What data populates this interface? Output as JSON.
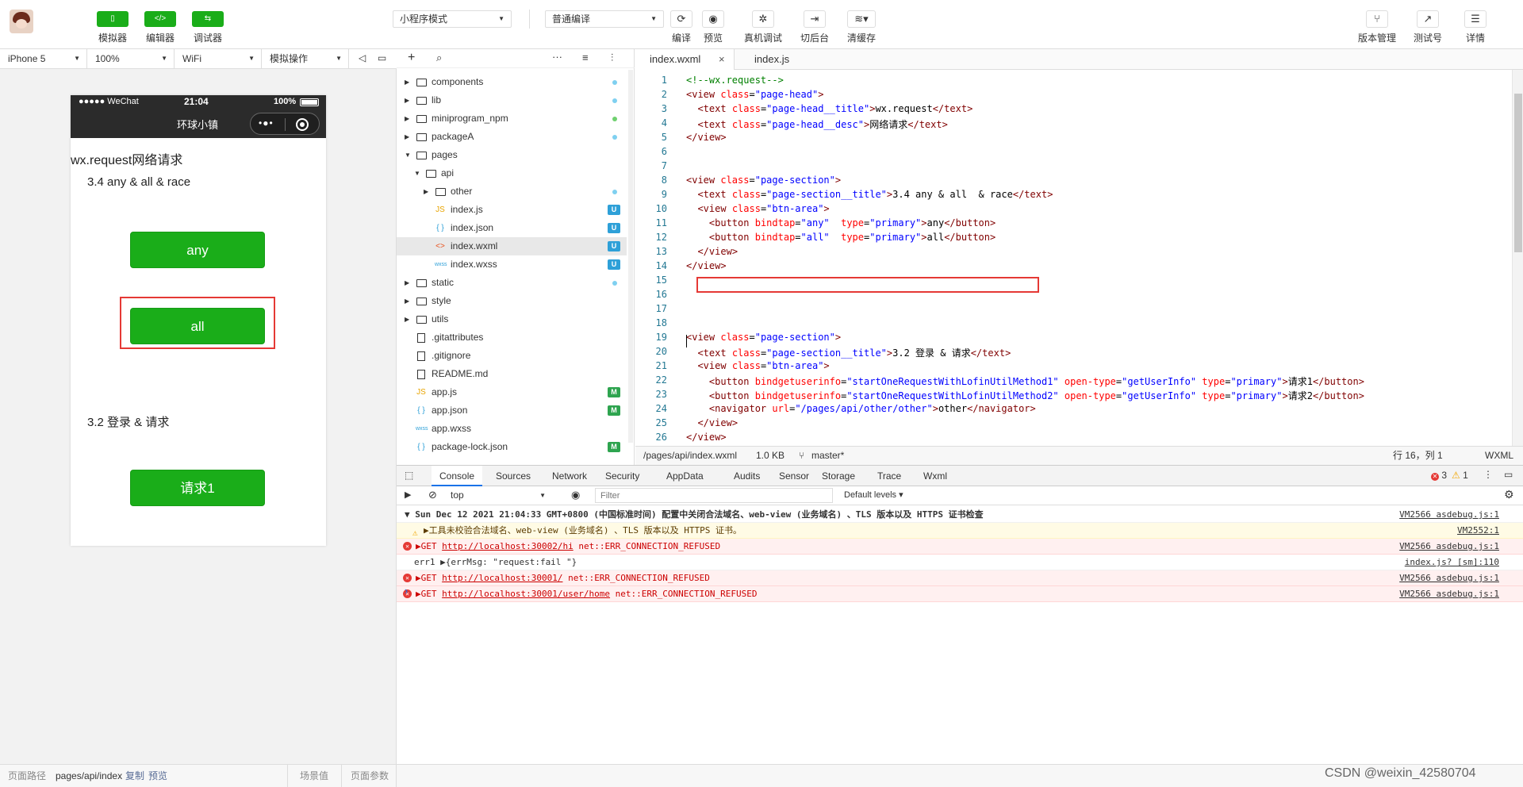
{
  "toolbar": {
    "simulator_label": "模拟器",
    "editor_label": "编辑器",
    "debugger_label": "调试器",
    "mode_select": "小程序模式",
    "compile_select": "普通编译",
    "compile_label": "编译",
    "preview_label": "预览",
    "remote_debug_label": "真机调试",
    "background_label": "切后台",
    "clear_cache_label": "清缓存",
    "version_label": "版本管理",
    "test_label": "测试号",
    "detail_label": "详情"
  },
  "devbar": {
    "device": "iPhone 5",
    "zoom": "100%",
    "network": "WiFi",
    "operation": "模拟操作"
  },
  "phone": {
    "carrier": "●●●●● WeChat",
    "time": "21:04",
    "battery": "100%",
    "nav_title": "环球小镇",
    "page_head": "wx.request网络请求",
    "section1_title": "3.4 any & all & race",
    "btn_any": "any",
    "btn_all": "all",
    "section2_title": "3.2 登录 & 请求",
    "btn_req1": "请求1"
  },
  "simfoot": {
    "path_label": "页面路径",
    "path": "pages/api/index",
    "copy": "复制",
    "preview": "预览",
    "scene": "场景值",
    "params": "页面参数"
  },
  "filetree": [
    {
      "name": "components",
      "type": "folder",
      "depth": 0,
      "open": false,
      "marker": "dot"
    },
    {
      "name": "lib",
      "type": "folder",
      "depth": 0,
      "open": false,
      "marker": "dot"
    },
    {
      "name": "miniprogram_npm",
      "type": "folder",
      "depth": 0,
      "open": false,
      "marker": "dot-green"
    },
    {
      "name": "packageA",
      "type": "folder",
      "depth": 0,
      "open": false,
      "marker": "dot"
    },
    {
      "name": "pages",
      "type": "folder",
      "depth": 0,
      "open": true,
      "marker": ""
    },
    {
      "name": "api",
      "type": "folder",
      "depth": 1,
      "open": true,
      "marker": ""
    },
    {
      "name": "other",
      "type": "folder",
      "depth": 2,
      "open": false,
      "marker": "dot"
    },
    {
      "name": "index.js",
      "type": "js",
      "depth": 2,
      "marker": "U"
    },
    {
      "name": "index.json",
      "type": "json",
      "depth": 2,
      "marker": "U"
    },
    {
      "name": "index.wxml",
      "type": "wxml",
      "depth": 2,
      "marker": "U",
      "selected": true
    },
    {
      "name": "index.wxss",
      "type": "wxss",
      "depth": 2,
      "marker": "U"
    },
    {
      "name": "static",
      "type": "folder",
      "depth": 0,
      "open": false,
      "marker": "dot"
    },
    {
      "name": "style",
      "type": "folder",
      "depth": 0,
      "open": false,
      "marker": ""
    },
    {
      "name": "utils",
      "type": "folder",
      "depth": 0,
      "open": false,
      "marker": ""
    },
    {
      "name": ".gitattributes",
      "type": "file",
      "depth": 0,
      "marker": ""
    },
    {
      "name": ".gitignore",
      "type": "file",
      "depth": 0,
      "marker": ""
    },
    {
      "name": "README.md",
      "type": "file",
      "depth": 0,
      "marker": ""
    },
    {
      "name": "app.js",
      "type": "js",
      "depth": 0,
      "marker": "M"
    },
    {
      "name": "app.json",
      "type": "json",
      "depth": 0,
      "marker": "M"
    },
    {
      "name": "app.wxss",
      "type": "wxss",
      "depth": 0,
      "marker": ""
    },
    {
      "name": "package-lock.json",
      "type": "json",
      "depth": 0,
      "marker": "M"
    }
  ],
  "editor": {
    "tabs": [
      "index.wxml",
      "index.js"
    ],
    "lines": [
      "<!--wx.request-->",
      "<view class=\"page-head\">",
      "  <text class=\"page-head__title\">wx.request</text>",
      "  <text class=\"page-head__desc\">网络请求</text>",
      "</view>",
      "",
      "",
      "<view class=\"page-section\">",
      "  <text class=\"page-section__title\">3.4 any & all  & race</text>",
      "  <view class=\"btn-area\">",
      "    <button bindtap=\"any\"  type=\"primary\">any</button>",
      "    <button bindtap=\"all\"  type=\"primary\">all</button>",
      "  </view>",
      "</view>",
      "",
      "",
      "",
      "",
      "<view class=\"page-section\">",
      "  <text class=\"page-section__title\">3.2 登录 & 请求</text>",
      "  <view class=\"btn-area\">",
      "    <button bindgetuserinfo=\"startOneRequestWithLofinUtilMethod1\" open-type=\"getUserInfo\" type=\"primary\">请求1</button>",
      "    <button bindgetuserinfo=\"startOneRequestWithLofinUtilMethod2\" open-type=\"getUserInfo\" type=\"primary\">请求2</button>",
      "    <navigator url=\"/pages/api/other/other\">other</navigator>",
      "  </view>",
      "</view>"
    ],
    "status_path": "/pages/api/index.wxml",
    "status_size": "1.0 KB",
    "status_branch": "master*",
    "status_pos": "行 16，列 1",
    "status_lang": "WXML"
  },
  "devtools": {
    "tabs": [
      "Console",
      "Sources",
      "Network",
      "Security",
      "AppData",
      "Audits",
      "Sensor",
      "Storage",
      "Trace",
      "Wxml"
    ],
    "err_count": "3",
    "warn_count": "1",
    "context": "top",
    "filter_placeholder": "Filter",
    "levels": "Default levels ▾",
    "logs": [
      {
        "kind": "group",
        "text": "▼ Sun Dec 12 2021 21:04:33 GMT+0800 (中国标准时间) 配置中关闭合法域名、web-view (业务域名) 、TLS 版本以及 HTTPS 证书检查",
        "src": "VM2566 asdebug.js:1"
      },
      {
        "kind": "warn",
        "text": "▶工具未校验合法域名、web-view (业务域名) 、TLS 版本以及 HTTPS 证书。",
        "src": "VM2552:1"
      },
      {
        "kind": "err",
        "pre": "▶GET ",
        "link": "http://localhost:30002/hi",
        "post": " net::ERR_CONNECTION_REFUSED",
        "src": "VM2566 asdebug.js:1"
      },
      {
        "kind": "log",
        "text": "err1 ▶{errMsg: \"request:fail \"}",
        "src": "index.js? [sm]:110"
      },
      {
        "kind": "err",
        "pre": "▶GET ",
        "link": "http://localhost:30001/",
        "post": " net::ERR_CONNECTION_REFUSED",
        "src": "VM2566 asdebug.js:1"
      },
      {
        "kind": "err",
        "pre": "▶GET ",
        "link": "http://localhost:30001/user/home",
        "post": " net::ERR_CONNECTION_REFUSED",
        "src": "VM2566 asdebug.js:1"
      }
    ],
    "prompt": "›"
  },
  "watermark": "CSDN @weixin_42580704"
}
